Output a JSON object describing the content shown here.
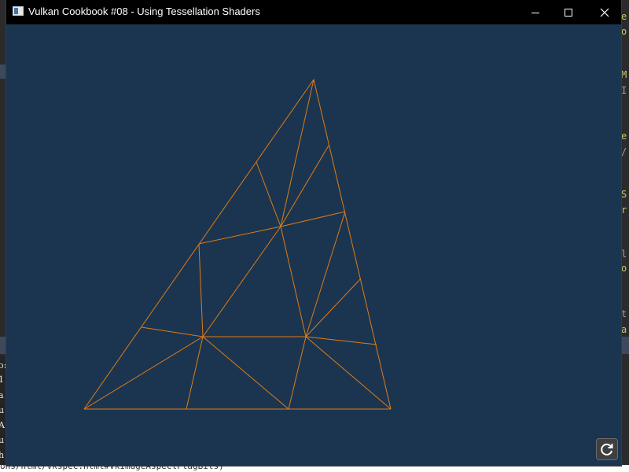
{
  "window": {
    "title": "Vulkan Cookbook #08 - Using Tessellation Shaders",
    "icon": "app-window-icon",
    "controls": [
      "minimize-icon",
      "maximize-icon",
      "close-icon"
    ]
  },
  "scene": {
    "background_color": "#1b3550",
    "wireframe_color": "#e07b14",
    "primitive": "tessellated-triangle-wireframe"
  },
  "overlay": {
    "refresh_icon": "refresh-icon"
  },
  "background_editor": {
    "status_text": "ons/html/vkspec.html#VkImageAspectFlagBits)",
    "left_fragments": [
      "o:",
      "1",
      "a",
      "u",
      "A",
      "u",
      "h"
    ],
    "right_fragments": [
      "e",
      "o",
      "M",
      "I",
      "e",
      "/",
      "S",
      "r",
      "l",
      "o",
      "t",
      "a"
    ]
  }
}
